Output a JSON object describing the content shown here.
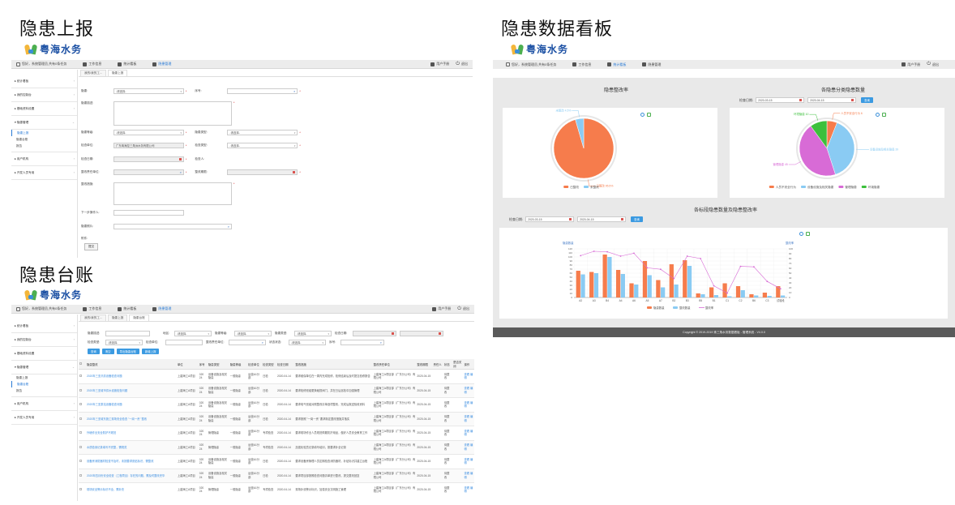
{
  "section_titles": {
    "report": "隐患上报",
    "ledger": "隐患台账",
    "dashboard": "隐患数据看板"
  },
  "brand": {
    "name": "粤海水务"
  },
  "topbar": {
    "greeting": "您好，系统管理员,共有0条任务",
    "nav": [
      "工作信息",
      "统计看板",
      "隐患管理"
    ],
    "user": "用户手册",
    "logout": "退出"
  },
  "sidebar": {
    "items": [
      "统计看板",
      "我的控制台",
      "基础资料设置",
      "隐患管理",
      "用户机构",
      "开发人员专用"
    ],
    "sub": [
      "隐患上报",
      "隐患台账",
      "报告"
    ]
  },
  "report": {
    "tabs": [
      "我的/我的工...",
      "隐患上报"
    ],
    "fields": {
      "category": "隐患:",
      "category_val": "-请选择-",
      "number": "序号:",
      "desc": "隐患描述:",
      "level": "隐患等级:",
      "level_val": "-请选择-",
      "type": "隐患类型:",
      "type_val": "-请选择-",
      "unit": "检查单位:",
      "unit_val": "广东粤海控三角洲水务有限公司",
      "check_type": "检查类型:",
      "check_type_val": "-请选择-",
      "date": "检查日期:",
      "checker": "检查人:",
      "resp_unit": "整改责任单位:",
      "deadline": "整改期限:",
      "measure": "整改措施:",
      "next": "下一步操作人:",
      "photo": "隐患照片:",
      "attach": "附件:",
      "upload": "提交"
    }
  },
  "ledger": {
    "tabs": [
      "我的/我的工...",
      "隐患上报",
      "隐患台账"
    ],
    "filters": {
      "name": "隐患描述:",
      "area": "地区:",
      "level": "隐患等级:",
      "type": "隐患类型:",
      "date": "检查日期:",
      "check_type": "检查类型:",
      "dept": "检查单位:",
      "resp": "整改责任单位:",
      "status": "状态状态:",
      "num": "序号:",
      "select": "-请选择-"
    },
    "buttons": [
      "查询",
      "清空",
      "导出隐患台账",
      "新增上报"
    ],
    "columns": [
      "隐患整改",
      "单位",
      "序号",
      "隐患类型",
      "隐患等级",
      "检查单位",
      "检查类型",
      "检查日期",
      "整改措施",
      "整改责任单位",
      "整改期限",
      "责任人",
      "状态",
      "是否关闭",
      "操作"
    ],
    "rows": [
      {
        "title": "2020年三亚汛前设备检查问题",
        "unit": "上建海工A项目",
        "no": "020 24",
        "type": "设备设施及相关隐患",
        "level": "一般隐患",
        "dept": "运营A1分部",
        "ctype": "日检",
        "date": "2020-04-14",
        "measure": "要求维保单位在一周内完成检修，检修结束后及时提交检修报告",
        "resp": "上建海工A项目部（广东分公司）有限公司",
        "deadline": "2020-04-15",
        "who": "",
        "status": "待整改",
        "closed": "",
        "op": "查看 编辑"
      },
      {
        "title": "2020年三亚城市供水设施检查问题",
        "unit": "上建海工A项目",
        "no": "020 24",
        "type": "设备设施及相关隐患",
        "level": "一般隐患",
        "dept": "运营A1分部",
        "ctype": "日检",
        "date": "2020-04-14",
        "measure": "要求检修班组更换破损阀门，并在日后巡检中加强管理",
        "resp": "上建海工A项目部（广东分公司）有限公司",
        "deadline": "2020-04-15",
        "who": "",
        "status": "待整改",
        "closed": "",
        "op": "查看 编辑"
      },
      {
        "title": "2020年三亚泵站设备检查问题",
        "unit": "上建海工A项目",
        "no": "020 24",
        "type": "设备设施及相关隐患",
        "level": "一般隐患",
        "dept": "运营A1分部",
        "ctype": "日检",
        "date": "2020-04-14",
        "measure": "要求电气班组对照整改清单逐项整改，完成后报送验收资料",
        "resp": "上建海工A项目部（广东分公司）有限公司",
        "deadline": "2020-04-15",
        "who": "",
        "status": "待整改",
        "closed": "",
        "op": "查看 编辑"
      },
      {
        "title": "2020年三亚城东施工现场安全检查 \"一岗一责\" 整改",
        "unit": "上建海工A项目",
        "no": "020 24",
        "type": "设备设施及相关隐患",
        "level": "一般隐患",
        "dept": "运营A1分部",
        "ctype": "日检",
        "date": "2020-04-14",
        "measure": "要求按照 \"一岗一责\" 要求制定整改措施并落实",
        "resp": "上建海工A项目部（广东分公司）有限公司",
        "deadline": "2020-04-15",
        "who": "",
        "status": "待整改",
        "closed": "",
        "op": "查看 编辑"
      },
      {
        "title": "外墙作业安全防护不规范",
        "unit": "上建海工A项目",
        "no": "020 24",
        "type": "管理隐患",
        "level": "一般隐患",
        "dept": "运营A1分部",
        "ctype": "专项检查",
        "date": "2020-04-14",
        "measure": "要求现场作业人员规范佩戴防护用品，做好人员安全教育工作",
        "resp": "上建海工A项目部（广东分公司）有限公司",
        "deadline": "2020-04-15",
        "who": "",
        "status": "待整改",
        "closed": "",
        "op": "查看 编辑"
      },
      {
        "title": "水质检测记录填写不完整，需规范",
        "unit": "上建海工A项目",
        "no": "020 24",
        "type": "管理隐患",
        "level": "一般隐患",
        "dept": "运营A1分部",
        "ctype": "专项检查",
        "date": "2020-04-14",
        "measure": "加强化验员记录填写培训，按要求补全记录",
        "resp": "上建海工A项目部（广东分公司）有限公司",
        "deadline": "2020-04-15",
        "who": "",
        "status": "待整改",
        "closed": "",
        "op": "查看 编辑"
      },
      {
        "title": "设备房消防器材检查不及时，未按要求张贴标识，需整改",
        "unit": "上建海工A项目",
        "no": "020 24",
        "type": "设备设施及相关隐患",
        "level": "一般隐患",
        "dept": "运营A1分部",
        "ctype": "日检",
        "date": "2020-04-14",
        "measure": "要求设备房管理人员定期检查消防器材，补贴标识并建立台账",
        "resp": "上建海工A项目部（广东分公司）有限公司",
        "deadline": "2020-04-15",
        "who": "",
        "status": "待整改",
        "closed": "",
        "op": "查看 编辑"
      },
      {
        "title": "2020年四月份安全检查（工程项目）存在的问题，需及时整改完毕",
        "unit": "上建海工A项目",
        "no": "020 24",
        "type": "设备设施及相关隐患",
        "level": "一般隐患",
        "dept": "运营A1分部",
        "ctype": "日检",
        "date": "2020-04-14",
        "measure": "要求项目部按照检查问题清单进行整改，提交整改回复",
        "resp": "上建海工A项目部（广东分公司）有限公司",
        "deadline": "2020-04-15",
        "who": "",
        "status": "待整改",
        "closed": "",
        "op": "查看 编辑"
      },
      {
        "title": "现场安全警示标识不全，需补充",
        "unit": "上建海工A项目",
        "no": "020 24",
        "type": "管理隐患",
        "level": "一般隐患",
        "dept": "运营A1分部",
        "ctype": "专项检查",
        "date": "2020-04-14",
        "measure": "现场补设警示标识，加强安全文明施工管理",
        "resp": "上建海工A项目部（广东分公司）有限公司",
        "deadline": "2020-04-15",
        "who": "",
        "status": "待整改",
        "closed": "",
        "op": "查看 编辑"
      }
    ]
  },
  "dashboard": {
    "nav": [
      "工作信息",
      "统计看板",
      "隐患管理"
    ],
    "rate_title": "隐患整改率",
    "category_title": "各隐患分类隐患数量",
    "dept_title": "各标段隐患数量及隐患整改率",
    "date_label": "检查日期:",
    "date_from": "2020-03-15",
    "date_to": "2020-04-15",
    "query": "查询",
    "footer": "Copyright © 2019-2019 珠三角水务数据看板 - 管理系统 - V4.0.0"
  },
  "chart_data": [
    {
      "type": "pie",
      "title": "隐患整改率",
      "labels": [
        "已整改",
        "未整改"
      ],
      "values": [
        95.5,
        4.5
      ],
      "colors": [
        "#f67c4c",
        "#8acbf3"
      ],
      "slice_labels": [
        "已整改 95.5%",
        "未整改 4.5%"
      ]
    },
    {
      "type": "pie",
      "title": "各隐患分类隐患数量",
      "labels": [
        "人员不安全行为",
        "设备设施及相关隐患",
        "管理隐患",
        "环境隐患"
      ],
      "values": [
        6,
        39,
        45,
        10
      ],
      "colors": [
        "#f67c4c",
        "#8acbf3",
        "#d86bd6",
        "#3cc03c"
      ],
      "legend": "bottom"
    },
    {
      "type": "bar",
      "title": "各标段隐患数量及隐患整改率",
      "categories": [
        "A2",
        "A3",
        "B4",
        "A4",
        "A6",
        "A5",
        "A7",
        "B2",
        "B3",
        "B5",
        "B1",
        "C1",
        "C2",
        "B6",
        "C3",
        "试验段"
      ],
      "series": [
        {
          "name": "隐患数量",
          "values": [
            66,
            63,
            106,
            68,
            35,
            90,
            43,
            82,
            92,
            10,
            25,
            35,
            28,
            8,
            12,
            28
          ],
          "color": "#f67c4c"
        },
        {
          "name": "整改数量",
          "values": [
            57,
            60,
            100,
            58,
            32,
            55,
            25,
            32,
            78,
            8,
            6,
            3,
            18,
            5,
            4,
            5
          ],
          "color": "#8acbf3"
        },
        {
          "name": "整改率",
          "values": [
            86,
            95,
            94,
            85,
            91,
            61,
            58,
            39,
            85,
            80,
            24,
            9,
            64,
            63,
            33,
            18
          ],
          "color": "#d86bd6",
          "axis": "right",
          "kind": "line"
        }
      ],
      "ylabel": "隐患数量",
      "y2label": "整改率",
      "ylim": [
        0,
        120
      ],
      "y2lim": [
        0,
        100
      ],
      "legend": "bottom",
      "grid": true
    }
  ]
}
